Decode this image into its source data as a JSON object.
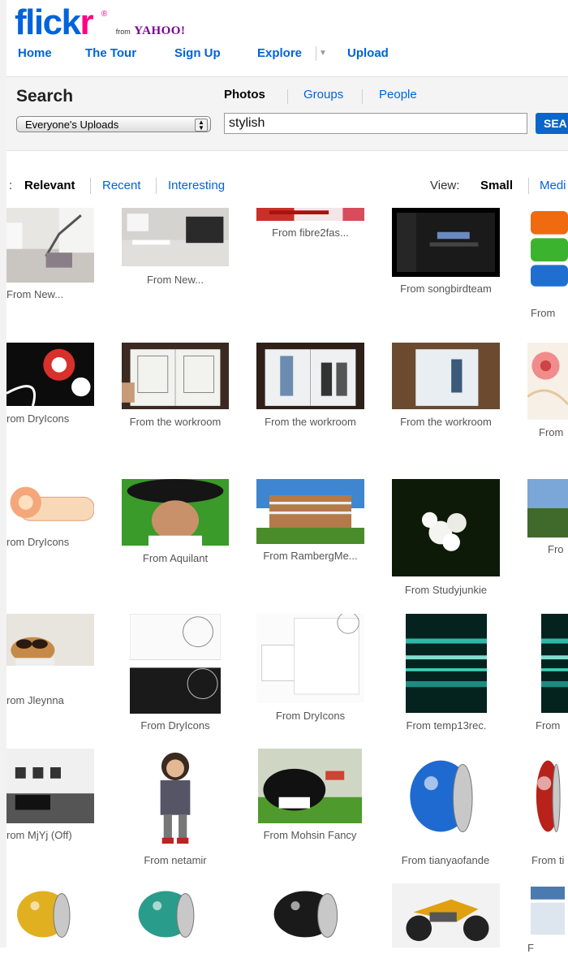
{
  "logo": {
    "brand_blue": "flick",
    "brand_pink": "r",
    "reg": "®",
    "from": "from",
    "yahoo": "YAHOO!"
  },
  "nav": {
    "home": "Home",
    "tour": "The Tour",
    "signup": "Sign Up",
    "explore": "Explore",
    "explore_dd": "▼",
    "upload": "Upload"
  },
  "search": {
    "title": "Search",
    "tabs": [
      "Photos",
      "Groups",
      "People"
    ],
    "scope": "Everyone's Uploads",
    "query": "stylish",
    "button": "SEA"
  },
  "sort": {
    "prefix": ":",
    "relevant": "Relevant",
    "recent": "Recent",
    "interesting": "Interesting"
  },
  "view": {
    "label": "View:",
    "small": "Small",
    "medium": "Medi"
  },
  "colors": {
    "link": "#0063dc",
    "brand_pink": "#ff0084",
    "yahoo_purple": "#7b0099",
    "search_button": "#0a66c8"
  },
  "results": [
    {
      "caption": "From New...",
      "kind": "interior-stairs"
    },
    {
      "caption": "From New...",
      "kind": "interior-kitchen"
    },
    {
      "caption": "From fibre2fas...",
      "kind": "banner"
    },
    {
      "caption": "From songbirdteam",
      "kind": "screen-dark"
    },
    {
      "caption": "From",
      "kind": "color-bars"
    },
    {
      "caption": "rom DryIcons",
      "kind": "floral-black"
    },
    {
      "caption": "From the workroom",
      "kind": "book-sketch"
    },
    {
      "caption": "From the workroom",
      "kind": "book-photos"
    },
    {
      "caption": "From the workroom",
      "kind": "book-wood"
    },
    {
      "caption": "From",
      "kind": "floral-pink"
    },
    {
      "caption": "rom DryIcons",
      "kind": "floral-badge"
    },
    {
      "caption": "From Aquilant",
      "kind": "portrait-hat"
    },
    {
      "caption": "From RambergMe...",
      "kind": "building"
    },
    {
      "caption": "From Studyjunkie",
      "kind": "flowers-white"
    },
    {
      "caption": "Fro",
      "kind": "landscape"
    },
    {
      "caption": "rom Jleynna",
      "kind": "dog-glasses"
    },
    {
      "caption": "From DryIcons",
      "kind": "business-cards"
    },
    {
      "caption": "From DryIcons",
      "kind": "stationery"
    },
    {
      "caption": "From temp13rec.",
      "kind": "teal-lines"
    },
    {
      "caption": "From",
      "kind": "teal-lines-2"
    },
    {
      "caption": "rom MjYj (Off)",
      "kind": "gallery-room"
    },
    {
      "caption": "From netamir",
      "kind": "doll"
    },
    {
      "caption": "From Mohsin Fancy",
      "kind": "cat-bottle"
    },
    {
      "caption": "From tianyaofande",
      "kind": "bead-blue"
    },
    {
      "caption": "From ti",
      "kind": "bead-red"
    },
    {
      "caption": "",
      "kind": "bead-yellow"
    },
    {
      "caption": "",
      "kind": "bead-teal"
    },
    {
      "caption": "",
      "kind": "bead-black"
    },
    {
      "caption": "",
      "kind": "motorbike"
    },
    {
      "caption": "F",
      "kind": "website"
    }
  ]
}
